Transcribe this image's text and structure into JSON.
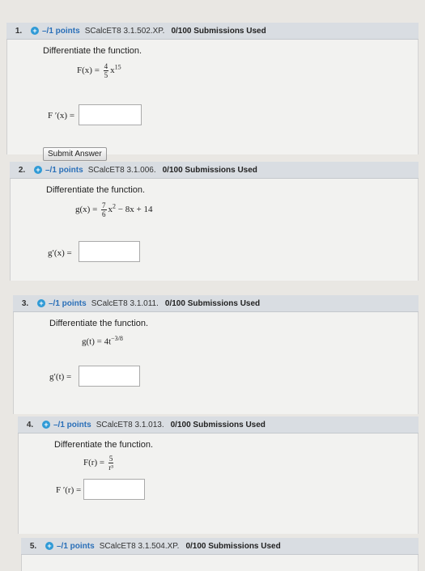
{
  "questions": [
    {
      "number": "1.",
      "points": "–/1 points",
      "source": "SCalcET8 3.1.502.XP.",
      "submissions": "0/100 Submissions Used",
      "prompt": "Differentiate the function.",
      "lhs": "F(x) =",
      "frac_num": "4",
      "frac_den": "5",
      "rest": "x",
      "sup": "15",
      "answer_label": "F ′(x) =",
      "answer_value": "",
      "submit_label": "Submit Answer"
    },
    {
      "number": "2.",
      "points": "–/1 points",
      "source": "SCalcET8 3.1.006.",
      "submissions": "0/100 Submissions Used",
      "prompt": "Differentiate the function.",
      "lhs": "g(x) =",
      "frac_num": "7",
      "frac_den": "6",
      "rest": "x",
      "sup": "2",
      "tail": "− 8x + 14",
      "answer_label": "g′(x) =",
      "answer_value": ""
    },
    {
      "number": "3.",
      "points": "–/1 points",
      "source": "SCalcET8 3.1.011.",
      "submissions": "0/100 Submissions Used",
      "prompt": "Differentiate the function.",
      "lhs": "g(t) = 4t",
      "sup": "−3/8",
      "answer_label": "g′(t) =",
      "answer_value": ""
    },
    {
      "number": "4.",
      "points": "–/1 points",
      "source": "SCalcET8 3.1.013.",
      "submissions": "0/100 Submissions Used",
      "prompt": "Differentiate the function.",
      "lhs": "F(r) =",
      "frac_num": "5",
      "frac_den": "r³",
      "answer_label": "F ′(r) =",
      "answer_value": ""
    },
    {
      "number": "5.",
      "points": "–/1 points",
      "source": "SCalcET8 3.1.504.XP.",
      "submissions": "0/100 Submissions Used"
    }
  ]
}
